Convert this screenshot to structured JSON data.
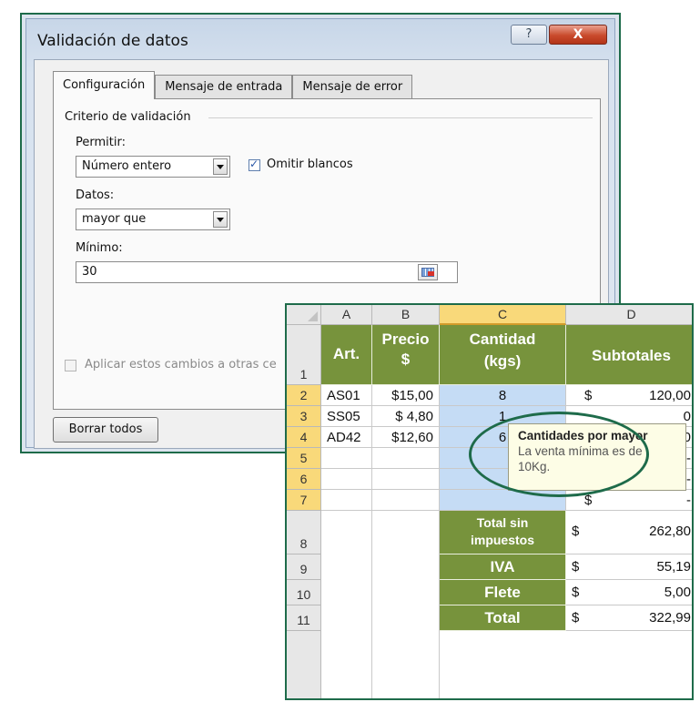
{
  "dialog": {
    "title": "Validación de datos",
    "help_label": "?",
    "close_label": "X",
    "tabs": [
      "Configuración",
      "Mensaje de entrada",
      "Mensaje de error"
    ],
    "group_label": "Criterio de validación",
    "permitir_label": "Permitir:",
    "permitir_value": "Número entero",
    "omitir_label": "Omitir blancos",
    "omitir_checked": true,
    "datos_label": "Datos:",
    "datos_value": "mayor que",
    "minimo_label": "Mínimo:",
    "minimo_value": "30",
    "aplicar_label": "Aplicar estos cambios a otras ce",
    "borrar_label": "Borrar todos"
  },
  "sheet": {
    "columns": [
      "A",
      "B",
      "C",
      "D"
    ],
    "rows": [
      "1",
      "2",
      "3",
      "4",
      "5",
      "6",
      "7",
      "8",
      "9",
      "10",
      "11"
    ],
    "headers": {
      "a": "Art.",
      "b1": "Precio",
      "b2": "$",
      "c1": "Cantidad",
      "c2": "(kgs)",
      "d": "Subtotales"
    },
    "data": [
      {
        "art": "AS01",
        "precio": "$15,00",
        "cant": "8",
        "cur": "$",
        "sub": "120,00"
      },
      {
        "art": "SS05",
        "precio": "$  4,80",
        "cant": "1",
        "cur": "",
        "sub": "0"
      },
      {
        "art": "AD42",
        "precio": "$12,60",
        "cant": "6",
        "cur": "",
        "sub": "0"
      },
      {
        "art": "",
        "precio": "",
        "cant": "",
        "cur": "",
        "sub": "-"
      },
      {
        "art": "",
        "precio": "",
        "cant": "",
        "cur": "$",
        "sub": "-"
      },
      {
        "art": "",
        "precio": "",
        "cant": "",
        "cur": "$",
        "sub": "-"
      }
    ],
    "totals": [
      {
        "label1": "Total sin",
        "label2": "impuestos",
        "cur": "$",
        "value": "262,80"
      },
      {
        "label1": "IVA",
        "label2": "",
        "cur": "$",
        "value": "55,19"
      },
      {
        "label1": "Flete",
        "label2": "",
        "cur": "$",
        "value": "5,00"
      },
      {
        "label1": "Total",
        "label2": "",
        "cur": "$",
        "value": "322,99"
      }
    ]
  },
  "tooltip": {
    "title": "Cantidades por mayor",
    "line1": "La venta mínima es de",
    "line2": "10Kg."
  },
  "colors": {
    "header_green": "#77933c",
    "selection_blue": "#c5dcf5",
    "header_selected": "#f9d97a",
    "ring": "#1e6b4a"
  }
}
